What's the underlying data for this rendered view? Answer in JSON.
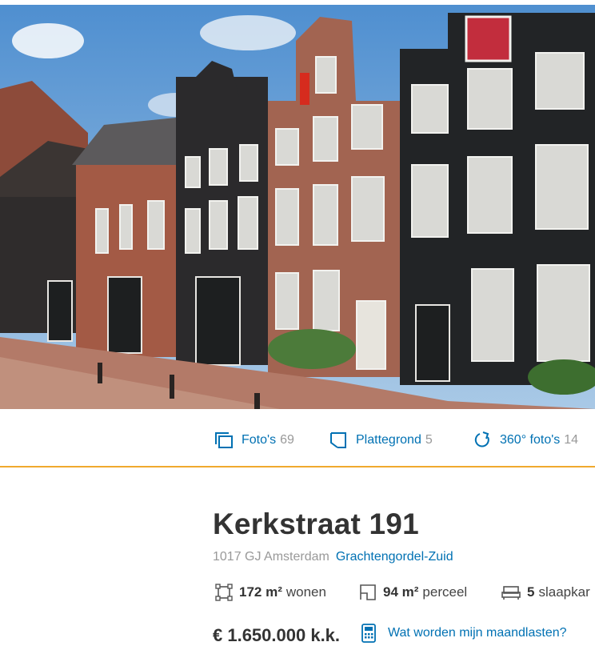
{
  "media": {
    "photos": {
      "label": "Foto's",
      "count": "69"
    },
    "floorplan": {
      "label": "Plattegrond",
      "count": "5"
    },
    "tour360": {
      "label": "360° foto's",
      "count": "14"
    }
  },
  "listing": {
    "address": "Kerkstraat 191",
    "postal_city": "1017 GJ Amsterdam",
    "neighbourhood": "Grachtengordel-Zuid",
    "features": [
      {
        "value": "172 m²",
        "label": "wonen",
        "icon": "living-area-icon"
      },
      {
        "value": "94 m²",
        "label": "perceel",
        "icon": "plot-area-icon"
      },
      {
        "value": "5",
        "label": "slaapkar",
        "icon": "bed-icon"
      }
    ],
    "price": "€ 1.650.000 k.k.",
    "monthly_costs_label": "Wat worden mijn maandlasten?"
  },
  "colors": {
    "link": "#0071b3",
    "accent": "#f0a92e",
    "text": "#333333",
    "muted": "#999999"
  }
}
